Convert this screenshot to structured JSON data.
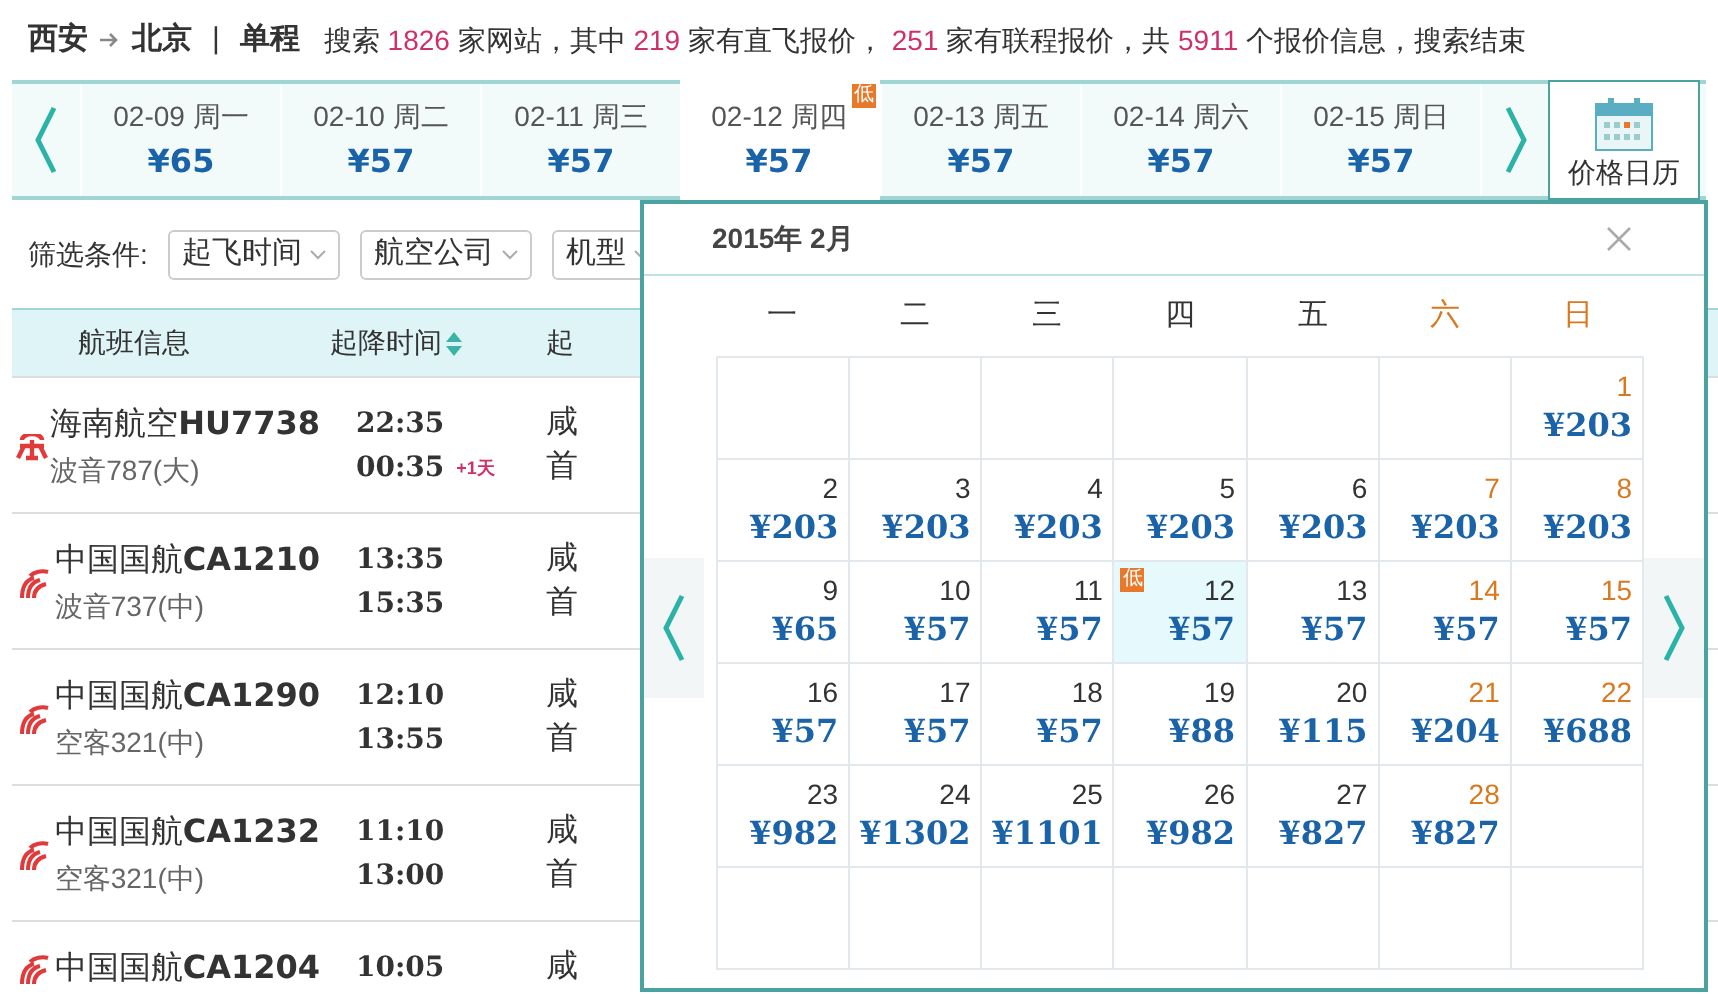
{
  "header": {
    "origin": "西安",
    "destination": "北京",
    "separator": "|",
    "trip_type": "单程",
    "summary": [
      {
        "kind": "plain",
        "text": "搜索"
      },
      {
        "kind": "number",
        "text": "1826"
      },
      {
        "kind": "plain",
        "text": "家网站，其中"
      },
      {
        "kind": "number",
        "text": "219"
      },
      {
        "kind": "plain",
        "text": "家有直飞报价，"
      },
      {
        "kind": "number",
        "text": "251"
      },
      {
        "kind": "plain",
        "text": "家有联程报价，共"
      },
      {
        "kind": "number",
        "text": "5911"
      },
      {
        "kind": "plain",
        "text": "个报价信息，搜索结束"
      }
    ]
  },
  "date_strip": {
    "days": [
      {
        "date": "02-09 周一",
        "price": "¥65",
        "selected": false
      },
      {
        "date": "02-10 周二",
        "price": "¥57",
        "selected": false
      },
      {
        "date": "02-11 周三",
        "price": "¥57",
        "selected": false
      },
      {
        "date": "02-12 周四",
        "price": "¥57",
        "selected": true,
        "badge": "低"
      },
      {
        "date": "02-13 周五",
        "price": "¥57",
        "selected": false
      },
      {
        "date": "02-14 周六",
        "price": "¥57",
        "selected": false
      },
      {
        "date": "02-15 周日",
        "price": "¥57",
        "selected": false
      }
    ],
    "calendar_button": "价格日历"
  },
  "filters": {
    "label": "筛选条件:",
    "dropdowns": [
      "起飞时间",
      "航空公司",
      "机型"
    ]
  },
  "table": {
    "columns": [
      {
        "label": "航班信息",
        "sortable": false
      },
      {
        "label": "起降时间",
        "sortable": true
      },
      {
        "label": "起",
        "sortable": false
      }
    ],
    "rows": [
      {
        "kind": "hainan",
        "airline": "海南航空",
        "flight": "HU7738",
        "aircraft": "波音787(大)",
        "depart": "22:35",
        "arrive": "00:35",
        "next_day": "+1天",
        "column_3": [
          "咸",
          "首"
        ]
      },
      {
        "kind": "airchina",
        "airline": "中国国航",
        "flight": "CA1210",
        "aircraft": "波音737(中)",
        "depart": "13:35",
        "arrive": "15:35",
        "column_3": [
          "咸",
          "首"
        ]
      },
      {
        "kind": "airchina",
        "airline": "中国国航",
        "flight": "CA1290",
        "aircraft": "空客321(中)",
        "depart": "12:10",
        "arrive": "13:55",
        "column_3": [
          "咸",
          "首"
        ]
      },
      {
        "kind": "airchina",
        "airline": "中国国航",
        "flight": "CA1232",
        "aircraft": "空客321(中)",
        "depart": "11:10",
        "arrive": "13:00",
        "column_3": [
          "咸",
          "首"
        ]
      },
      {
        "kind": "airchina",
        "airline": "中国国航",
        "flight": "CA1204",
        "depart": "10:05",
        "column_3": [
          "咸"
        ]
      }
    ]
  },
  "calendar": {
    "title": "2015年 2月",
    "weekdays": [
      {
        "label": "一",
        "weekend": false
      },
      {
        "label": "二",
        "weekend": false
      },
      {
        "label": "三",
        "weekend": false
      },
      {
        "label": "四",
        "weekend": false
      },
      {
        "label": "五",
        "weekend": false
      },
      {
        "label": "六",
        "weekend": true
      },
      {
        "label": "日",
        "weekend": true
      }
    ],
    "weeks": [
      [
        {
          "kind": "empty"
        },
        {
          "kind": "empty"
        },
        {
          "kind": "empty"
        },
        {
          "kind": "empty"
        },
        {
          "kind": "empty"
        },
        {
          "kind": "empty"
        },
        {
          "kind": "day",
          "day": "1",
          "price": "¥203",
          "weekend": true,
          "selected": false
        }
      ],
      [
        {
          "kind": "day",
          "day": "2",
          "price": "¥203",
          "weekend": false,
          "selected": false
        },
        {
          "kind": "day",
          "day": "3",
          "price": "¥203",
          "weekend": false,
          "selected": false
        },
        {
          "kind": "day",
          "day": "4",
          "price": "¥203",
          "weekend": false,
          "selected": false
        },
        {
          "kind": "day",
          "day": "5",
          "price": "¥203",
          "weekend": false,
          "selected": false
        },
        {
          "kind": "day",
          "day": "6",
          "price": "¥203",
          "weekend": false,
          "selected": false
        },
        {
          "kind": "day",
          "day": "7",
          "price": "¥203",
          "weekend": true,
          "selected": false
        },
        {
          "kind": "day",
          "day": "8",
          "price": "¥203",
          "weekend": true,
          "selected": false
        }
      ],
      [
        {
          "kind": "day",
          "day": "9",
          "price": "¥65",
          "weekend": false,
          "selected": false
        },
        {
          "kind": "day",
          "day": "10",
          "price": "¥57",
          "weekend": false,
          "selected": false
        },
        {
          "kind": "day",
          "day": "11",
          "price": "¥57",
          "weekend": false,
          "selected": false
        },
        {
          "kind": "day",
          "day": "12",
          "price": "¥57",
          "weekend": false,
          "selected": true,
          "badge": "低"
        },
        {
          "kind": "day",
          "day": "13",
          "price": "¥57",
          "weekend": false,
          "selected": false
        },
        {
          "kind": "day",
          "day": "14",
          "price": "¥57",
          "weekend": true,
          "selected": false
        },
        {
          "kind": "day",
          "day": "15",
          "price": "¥57",
          "weekend": true,
          "selected": false
        }
      ],
      [
        {
          "kind": "day",
          "day": "16",
          "price": "¥57",
          "weekend": false,
          "selected": false
        },
        {
          "kind": "day",
          "day": "17",
          "price": "¥57",
          "weekend": false,
          "selected": false
        },
        {
          "kind": "day",
          "day": "18",
          "price": "¥57",
          "weekend": false,
          "selected": false
        },
        {
          "kind": "day",
          "day": "19",
          "price": "¥88",
          "weekend": false,
          "selected": false
        },
        {
          "kind": "day",
          "day": "20",
          "price": "¥115",
          "weekend": false,
          "selected": false
        },
        {
          "kind": "day",
          "day": "21",
          "price": "¥204",
          "weekend": true,
          "selected": false
        },
        {
          "kind": "day",
          "day": "22",
          "price": "¥688",
          "weekend": true,
          "selected": false
        }
      ],
      [
        {
          "kind": "day",
          "day": "23",
          "price": "¥982",
          "weekend": false,
          "selected": false
        },
        {
          "kind": "day",
          "day": "24",
          "price": "¥1302",
          "weekend": false,
          "selected": false
        },
        {
          "kind": "day",
          "day": "25",
          "price": "¥1101",
          "weekend": false,
          "selected": false
        },
        {
          "kind": "day",
          "day": "26",
          "price": "¥982",
          "weekend": false,
          "selected": false
        },
        {
          "kind": "day",
          "day": "27",
          "price": "¥827",
          "weekend": false,
          "selected": false
        },
        {
          "kind": "day",
          "day": "28",
          "price": "¥827",
          "weekend": true,
          "selected": false
        },
        {
          "kind": "empty"
        }
      ],
      [
        {
          "kind": "empty"
        },
        {
          "kind": "empty"
        },
        {
          "kind": "empty"
        },
        {
          "kind": "empty"
        },
        {
          "kind": "empty"
        },
        {
          "kind": "empty"
        },
        {
          "kind": "empty"
        }
      ]
    ]
  }
}
